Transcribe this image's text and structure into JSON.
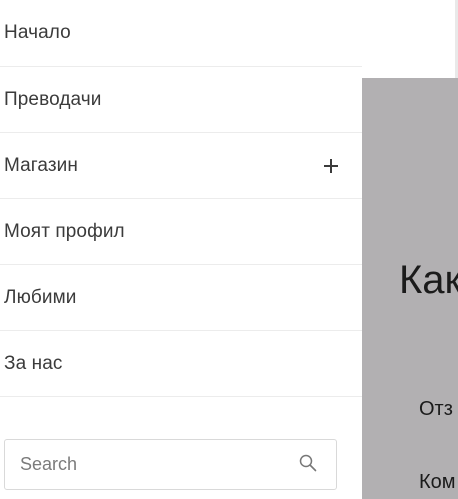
{
  "nav": {
    "items": [
      {
        "label": "Начало"
      },
      {
        "label": "Преводачи"
      },
      {
        "label": "Магазин",
        "expand_icon": "plus-icon"
      },
      {
        "label": "Моят профил"
      },
      {
        "label": "Любими"
      },
      {
        "label": "За нас"
      }
    ]
  },
  "search": {
    "placeholder": "Search",
    "value": "",
    "icon": "search-icon"
  },
  "background_page": {
    "heading": "Как",
    "line1": "Отз",
    "line2": "Ком"
  },
  "colors": {
    "menu_text": "#3b3b3b",
    "divider": "#ececec",
    "overlay": "#b2b0b2",
    "search_border": "#d9d9d9"
  }
}
